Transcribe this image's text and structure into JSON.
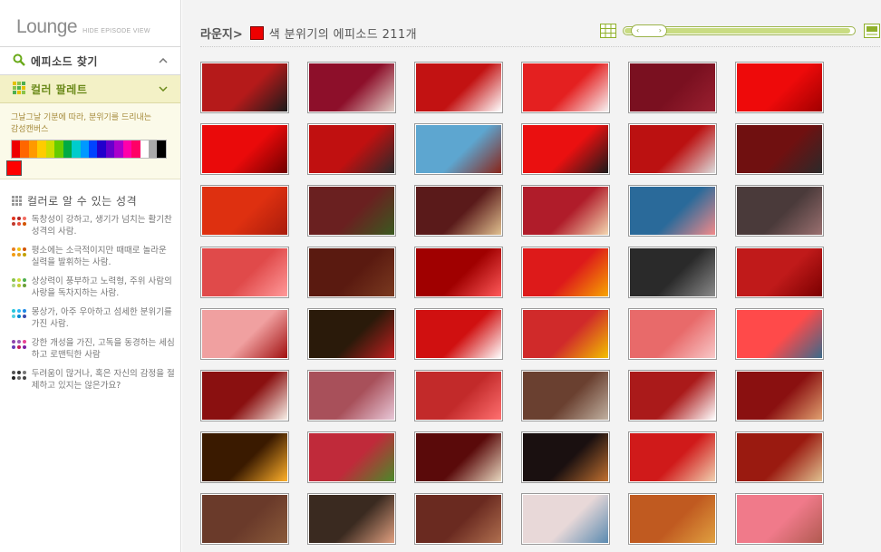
{
  "logo": {
    "brand": "Lounge",
    "subtitle": "HIDE EPISODE VIEW"
  },
  "sidebar": {
    "find_label": "에피소드 찾기",
    "palette_label": "컬러 팔레트",
    "palette_desc": "그날그날 기분에 따라, 분위기를 드리내는 감성캔버스",
    "palette_colors": [
      "#ee0000",
      "#ff6600",
      "#ff9900",
      "#ffcc00",
      "#ccdd00",
      "#66cc00",
      "#00aa44",
      "#00cccc",
      "#0099ff",
      "#0044ff",
      "#2200cc",
      "#6600cc",
      "#aa00cc",
      "#ff00aa",
      "#ff0066",
      "#ffffff",
      "#aaaaaa",
      "#000000"
    ],
    "selected_color": "#ff0000",
    "traits_label": "컬러로 알 수 있는 성격",
    "traits": [
      {
        "text": "독창성이 강하고, 생기가 넘치는 활기찬 성격의 사람.",
        "colors": [
          "#e1341e",
          "#b22222",
          "#f36c60",
          "#c0392b",
          "#e74c3c",
          "#d35400"
        ]
      },
      {
        "text": "평소에는 소극적이지만 때때로 놀라운 실력을 발휘하는 사람.",
        "colors": [
          "#e67e22",
          "#f1c40f",
          "#d35400",
          "#f39c12",
          "#e4a020",
          "#c2a200"
        ]
      },
      {
        "text": "상상력이 풍부하고 노력형, 주위 사람의 사랑을 독차지하는 사람.",
        "colors": [
          "#8bc34a",
          "#cddc39",
          "#4caf50",
          "#aed581",
          "#c0ca33",
          "#689f38"
        ]
      },
      {
        "text": "몽상가, 아주 우아하고 섬세한 분위기를 가진 사람.",
        "colors": [
          "#26c6da",
          "#29b6f6",
          "#1e88e5",
          "#4dd0e1",
          "#0288d1",
          "#3949ab"
        ]
      },
      {
        "text": "강한 개성을 가진, 고독을 동경하는 세심하고 로맨틱한 사람",
        "colors": [
          "#8e44ad",
          "#9b59b6",
          "#e84393",
          "#673ab7",
          "#c2185b",
          "#7b1fa2"
        ]
      },
      {
        "text": "두려움이 많거나, 혹은 자신의 감정을 절제하고 있지는 않은가요?",
        "colors": [
          "#555555",
          "#333333",
          "#777777",
          "#222222",
          "#666666",
          "#444444"
        ]
      }
    ]
  },
  "header": {
    "crumb": "라운지>",
    "title": "색 분위기의 에피소드 211개",
    "crumb_color": "#ee0000"
  },
  "slider": {
    "left_glyph": "‹",
    "right_glyph": "›",
    "value": 0.02
  },
  "thumbnails": [
    [
      "#b51a1a",
      "#1a1a1a"
    ],
    [
      "#8d0f2a",
      "#e2d0c8"
    ],
    [
      "#c21212",
      "#ffffff"
    ],
    [
      "#e42020",
      "#f7f2f2"
    ],
    [
      "#7a1020",
      "#9a2030"
    ],
    [
      "#ee0a0a",
      "#a00000"
    ],
    [
      "#ea0a0a",
      "#700000"
    ],
    [
      "#c01010",
      "#2a2a2a"
    ],
    [
      "#5da6d0",
      "#8a2418"
    ],
    [
      "#ea1010",
      "#1a1a1a"
    ],
    [
      "#bb1111",
      "#dcdcdc"
    ],
    [
      "#701010",
      "#2a2a2a"
    ],
    [
      "#de3010",
      "#a81c0c"
    ],
    [
      "#6a2020",
      "#3a5a20"
    ],
    [
      "#5a1a1a",
      "#e0c090"
    ],
    [
      "#b01c2a",
      "#f3d6b0"
    ],
    [
      "#2a6a9a",
      "#f28a8a"
    ],
    [
      "#4a3a3a",
      "#9a7070"
    ],
    [
      "#e04a4a",
      "#ff9a9a"
    ],
    [
      "#5a1a10",
      "#7a3a20"
    ],
    [
      "#a00000",
      "#ff5a5a"
    ],
    [
      "#dd1a1a",
      "#f7a500"
    ],
    [
      "#2a2a2a",
      "#8a8a8a"
    ],
    [
      "#c01a1a",
      "#7a0000"
    ],
    [
      "#f0a0a0",
      "#a01010"
    ],
    [
      "#2a1a0a",
      "#c22020"
    ],
    [
      "#d01010",
      "#ffffff"
    ],
    [
      "#d02a2a",
      "#f2c000"
    ],
    [
      "#e86a6a",
      "#f8c8c8"
    ],
    [
      "#ff4a4a",
      "#3a6a8a"
    ],
    [
      "#8a1010",
      "#f8f0e8"
    ],
    [
      "#a8505a",
      "#e8c8d8"
    ],
    [
      "#c22a2a",
      "#ff7070"
    ],
    [
      "#6a4030",
      "#c0b0a0"
    ],
    [
      "#aa1a1a",
      "#ffffff"
    ],
    [
      "#8a1010",
      "#e0a070"
    ],
    [
      "#3a1a00",
      "#ffb02a"
    ],
    [
      "#c02a3a",
      "#4a8a2a"
    ],
    [
      "#5a0a0a",
      "#e8d8c0"
    ],
    [
      "#1a1010",
      "#c07030"
    ],
    [
      "#d01a1a",
      "#f0d0b0"
    ],
    [
      "#9a1a10",
      "#e0c090"
    ],
    [
      "#6a3a2a",
      "#8a5a3a"
    ],
    [
      "#3a2a20",
      "#e0a080"
    ],
    [
      "#6a2a20",
      "#b07050"
    ],
    [
      "#e8d8d8",
      "#5a8ab0"
    ],
    [
      "#c05a20",
      "#e0a040"
    ],
    [
      "#f07a8a",
      "#b05a50"
    ]
  ]
}
